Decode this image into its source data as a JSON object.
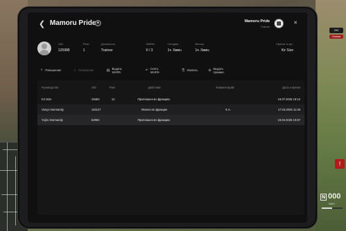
{
  "header": {
    "title": "Mamoru Pride",
    "org_name": "Mamoru Pride",
    "org_sub": "Trainee"
  },
  "profile": {
    "fields": [
      {
        "label": "UID:",
        "value": "125988"
      },
      {
        "label": "Ранг:",
        "value": "1"
      },
      {
        "label": "Должность:",
        "value": "Trainee"
      },
      {
        "label": "WARN:",
        "value": "0 / 3"
      },
      {
        "label": "Сегодня:",
        "value": "1ч. 6мин."
      },
      {
        "label": "Месяц:",
        "value": "1ч. 6мин."
      },
      {
        "label": "Принят в орг:",
        "value": "Kir Size"
      }
    ]
  },
  "actions": [
    {
      "label": "Повышение",
      "icon": "arrow-up-icon",
      "glyph": "⇡",
      "enabled": true
    },
    {
      "label": "Понижение",
      "icon": "arrow-down-icon",
      "glyph": "⇣",
      "enabled": false
    },
    {
      "label": "Выдать WARN",
      "icon": "warn-add-icon",
      "glyph": "▤",
      "enabled": true
    },
    {
      "label": "Снять WARN",
      "icon": "warn-remove-icon",
      "glyph": "↶",
      "enabled": true
    },
    {
      "label": "Уволить",
      "icon": "fire-icon",
      "glyph": "⎘",
      "enabled": true
    },
    {
      "label": "Выдать премию",
      "icon": "bonus-icon",
      "glyph": "⊕",
      "enabled": true
    }
  ],
  "table": {
    "columns": [
      "Руководство",
      "UID",
      "Ранг",
      "Действие",
      "Комментарий",
      "Дата и время"
    ],
    "rows": [
      {
        "manager": "Kir Size",
        "uid": "19484",
        "rank": "12",
        "action": "Приглашен во фракцию",
        "comment": "",
        "datetime": "16.07.2025 16:12"
      },
      {
        "manager": "Vanya Normandy",
        "uid": "116137",
        "rank": "",
        "action": "Уволен из фракции",
        "comment": "К.А.",
        "datetime": "17.04.2025 11:46"
      },
      {
        "manager": "Yujiro Normandy",
        "uid": "52084",
        "rank": "",
        "action": "Приглашен во фракцию",
        "comment": "",
        "datetime": "16.04.2025 10:57"
      }
    ]
  },
  "hud": {
    "badge": "200",
    "badge2": "Оплата",
    "alert": "!",
    "gear": "N",
    "speed": "000",
    "unit": "KM/H",
    "fuel_fraction": 0.5
  },
  "colors": {
    "tablet_bg": "#1d1d1f",
    "screen_bg": "#101011",
    "table_bg": "#161617",
    "accent_red": "#b01c1c"
  }
}
